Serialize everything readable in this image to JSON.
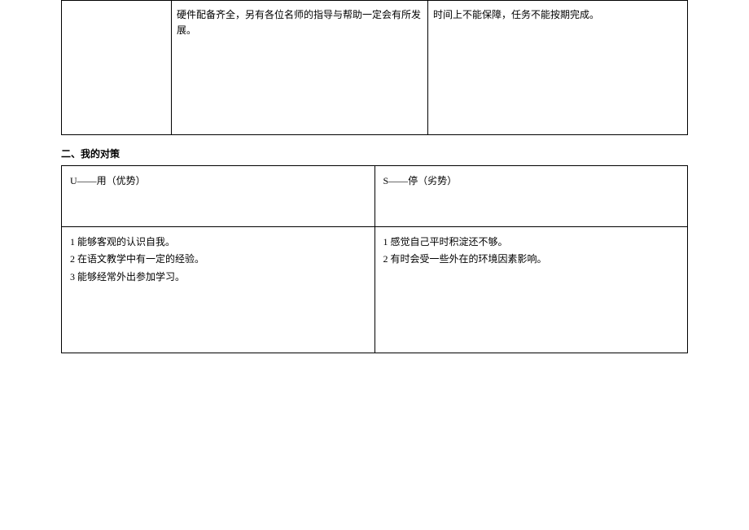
{
  "table1": {
    "col1": "",
    "col2": "硬件配备齐全，另有各位名师的指导与帮助一定会有所发展。",
    "col3": "时间上不能保障，任务不能按期完成。"
  },
  "section_title": "二、我的对策",
  "table2": {
    "header": {
      "left": "U——用（优势）",
      "right": "S——停（劣势）"
    },
    "left_items": {
      "l1": "1  能够客观的认识自我。",
      "l2": "2  在语文教学中有一定的经验。",
      "l3": "3  能够经常外出参加学习。"
    },
    "right_items": {
      "r1": "1 感觉自己平时积淀还不够。",
      "r2": "2 有时会受一些外在的环境因素影响。"
    }
  }
}
